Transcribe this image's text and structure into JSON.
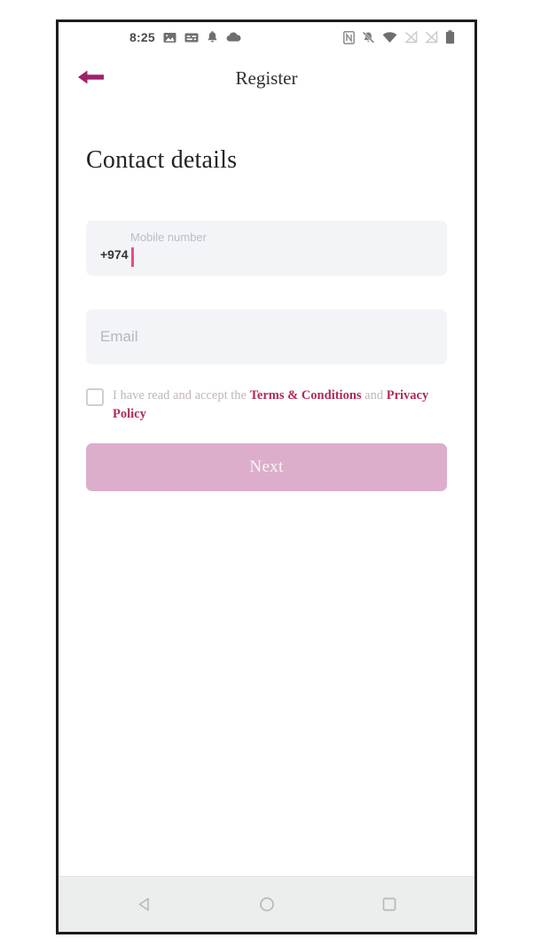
{
  "status_bar": {
    "time": "8:25",
    "left_icons": [
      "image-icon",
      "subtitles-icon",
      "bell-icon",
      "cloud-icon"
    ],
    "right_icons": [
      "nfc-icon",
      "bell-muted-icon",
      "wifi-icon",
      "signal-off-icon",
      "signal-off-2-icon",
      "battery-icon"
    ]
  },
  "app_bar": {
    "back_label": "back-arrow",
    "title": "Register"
  },
  "page": {
    "heading": "Contact details"
  },
  "form": {
    "phone": {
      "country_code": "+974",
      "label": "Mobile number",
      "value": ""
    },
    "email": {
      "placeholder": "Email",
      "value": ""
    },
    "terms": {
      "checked": false,
      "prefix": "I have read and accept the ",
      "link1": "Terms & Conditions",
      "conjunction": " and ",
      "link2": "Privacy Policy"
    },
    "submit_label": "Next"
  },
  "nav_bar": {
    "back": "nav-back-icon",
    "home": "nav-home-icon",
    "recents": "nav-recents-icon"
  },
  "colors": {
    "accent": "#b02a5b",
    "back_arrow": "#a0216b",
    "caret": "#ec4a86",
    "button": "#dcaecb",
    "field_bg": "#f2f4f7"
  }
}
